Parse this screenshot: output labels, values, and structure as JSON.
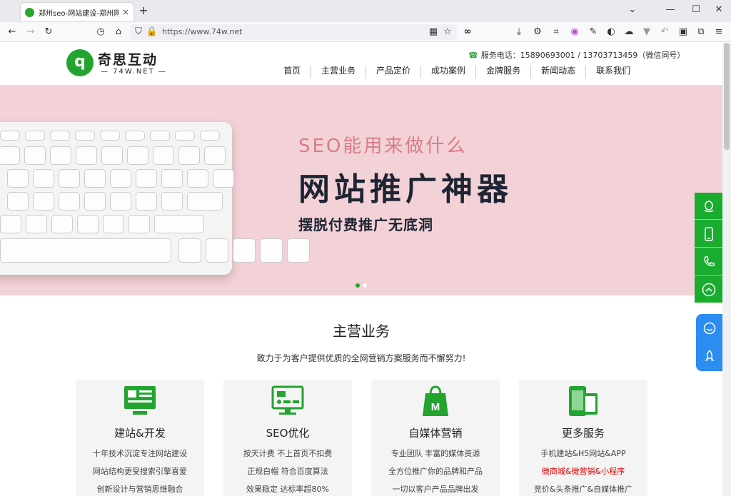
{
  "browser": {
    "tab_title": "郑州seo-网站建设-郑州网站优化",
    "tab_close": "×",
    "new_tab": "+",
    "url": "https://www.74w.net",
    "win_min": "⌄",
    "win_minimize": "—",
    "win_maximize": "☐",
    "win_close": "✕"
  },
  "site": {
    "logo_mark": "q",
    "logo_name": "奇思互动",
    "logo_sub": "— 74W.NET —",
    "hotline": "服务电话：15890693001 / 13703713459（微信同号）",
    "nav": [
      "首页",
      "主营业务",
      "产品定价",
      "成功案例",
      "金牌服务",
      "新闻动态",
      "联系我们"
    ]
  },
  "banner": {
    "line1": "SEO能用来做什么",
    "line2": "网站推广神器",
    "line3": "摆脱付费推广无底洞",
    "bg_color": "#f3d2d7",
    "accent_color": "#d97b87",
    "dot_active": "#22a42f",
    "dot_inactive": "#ffffff"
  },
  "services": {
    "title": "主营业务",
    "subtitle": "致力于为客户提供优质的全网营销方案服务而不懈努力!",
    "brand_color": "#22a42f",
    "cards": [
      {
        "icon": "web-dev-icon",
        "title": "建站&开发",
        "lines": [
          {
            "text": "十年技术沉淀专注网站建设",
            "red": false
          },
          {
            "text": "网站结构更受搜索引擎喜爱",
            "red": false
          },
          {
            "text": "创新设计与营销思维融合",
            "red": false
          }
        ]
      },
      {
        "icon": "seo-monitor-icon",
        "title": "SEO优化",
        "lines": [
          {
            "text": "按天计费 不上首页不扣费",
            "red": false
          },
          {
            "text": "正规白帽 符合百度算法",
            "red": false
          },
          {
            "text": "效果稳定 达标率超80%",
            "red": false
          }
        ]
      },
      {
        "icon": "shopping-bag-icon",
        "title": "自媒体营销",
        "lines": [
          {
            "text": "专业团队 丰富的媒体资源",
            "red": false
          },
          {
            "text": "全方位推广你的品牌和产品",
            "red": false
          },
          {
            "text": "一切以客户产品品牌出发",
            "red": false
          }
        ]
      },
      {
        "icon": "devices-icon",
        "title": "更多服务",
        "lines": [
          {
            "text": "手机建站&H5网站&APP",
            "red": false
          },
          {
            "text": "微商城&微营销&小程序",
            "red": true
          },
          {
            "text": "竞价&头条推广&自媒体推广",
            "red": false
          }
        ]
      }
    ]
  }
}
